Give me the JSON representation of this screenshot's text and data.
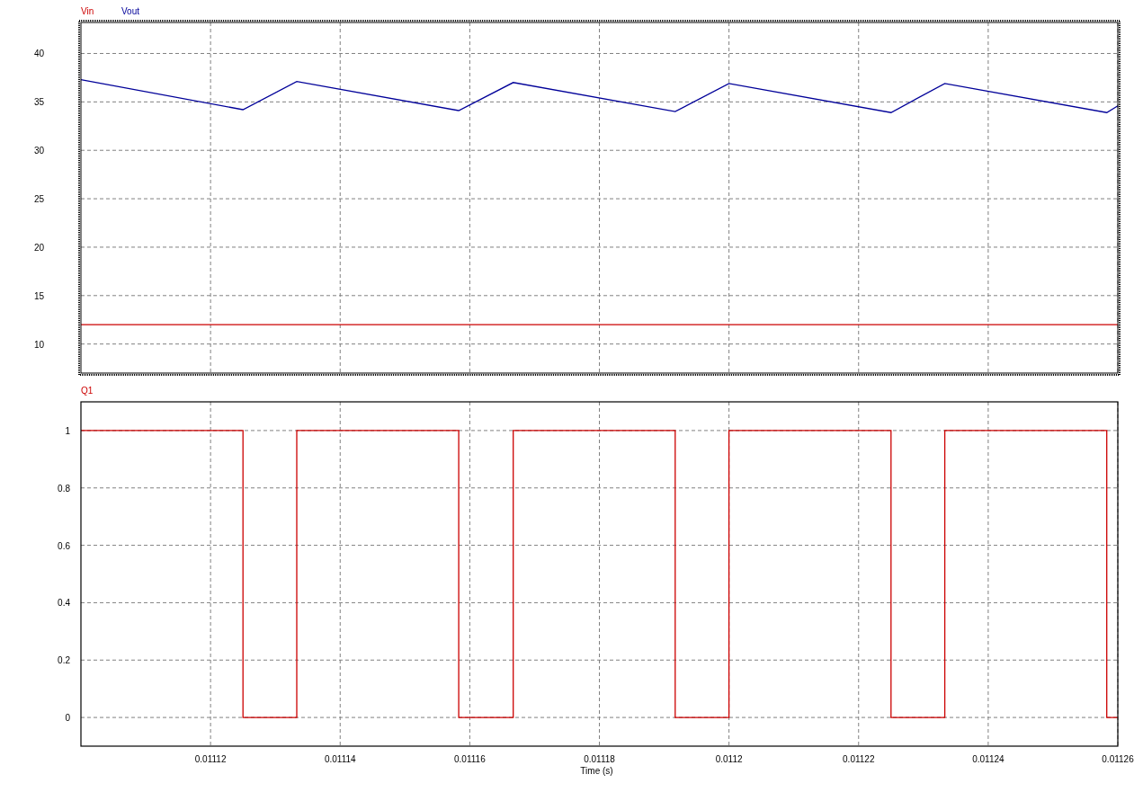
{
  "plots": [
    {
      "selected": true,
      "chart_data": {
        "type": "line",
        "x": [
          0.0111,
          0.011125,
          0.0111333,
          0.0111583,
          0.0111667,
          0.0111917,
          0.0112,
          0.011225,
          0.0112333,
          0.0112583,
          0.01126
        ],
        "series": [
          {
            "name": "Vin",
            "color": "#cc0000",
            "values": [
              12,
              12,
              12,
              12,
              12,
              12,
              12,
              12,
              12,
              12,
              12
            ]
          },
          {
            "name": "Vout",
            "color": "#000099",
            "values": [
              37.3,
              34.2,
              37.1,
              34.1,
              37.0,
              34.0,
              36.9,
              33.9,
              36.9,
              33.9,
              34.6
            ]
          }
        ],
        "xlim": [
          0.0111,
          0.01126
        ],
        "ylim": [
          7,
          43.2
        ],
        "yticks": [
          10,
          15,
          20,
          25,
          30,
          35,
          40
        ],
        "grid": true
      }
    },
    {
      "selected": false,
      "chart_data": {
        "type": "line",
        "xlabel": "Time (s)",
        "x": [
          0.0111,
          0.011125,
          0.011125,
          0.0111333,
          0.0111333,
          0.0111583,
          0.0111583,
          0.0111667,
          0.0111667,
          0.0111917,
          0.0111917,
          0.0112,
          0.0112,
          0.011225,
          0.011225,
          0.0112333,
          0.0112333,
          0.0112583,
          0.0112583,
          0.01126
        ],
        "series": [
          {
            "name": "Q1",
            "color": "#cc0000",
            "values": [
              1,
              1,
              0,
              0,
              1,
              1,
              0,
              0,
              1,
              1,
              0,
              0,
              1,
              1,
              0,
              0,
              1,
              1,
              0,
              0
            ]
          }
        ],
        "xlim": [
          0.0111,
          0.01126
        ],
        "ylim": [
          -0.1,
          1.1
        ],
        "xticks": [
          0.01112,
          0.01114,
          0.01116,
          0.01118,
          0.0112,
          0.01122,
          0.01124,
          0.01126
        ],
        "yticks": [
          0,
          0.2,
          0.4,
          0.6,
          0.8,
          1
        ],
        "grid": true
      }
    }
  ]
}
